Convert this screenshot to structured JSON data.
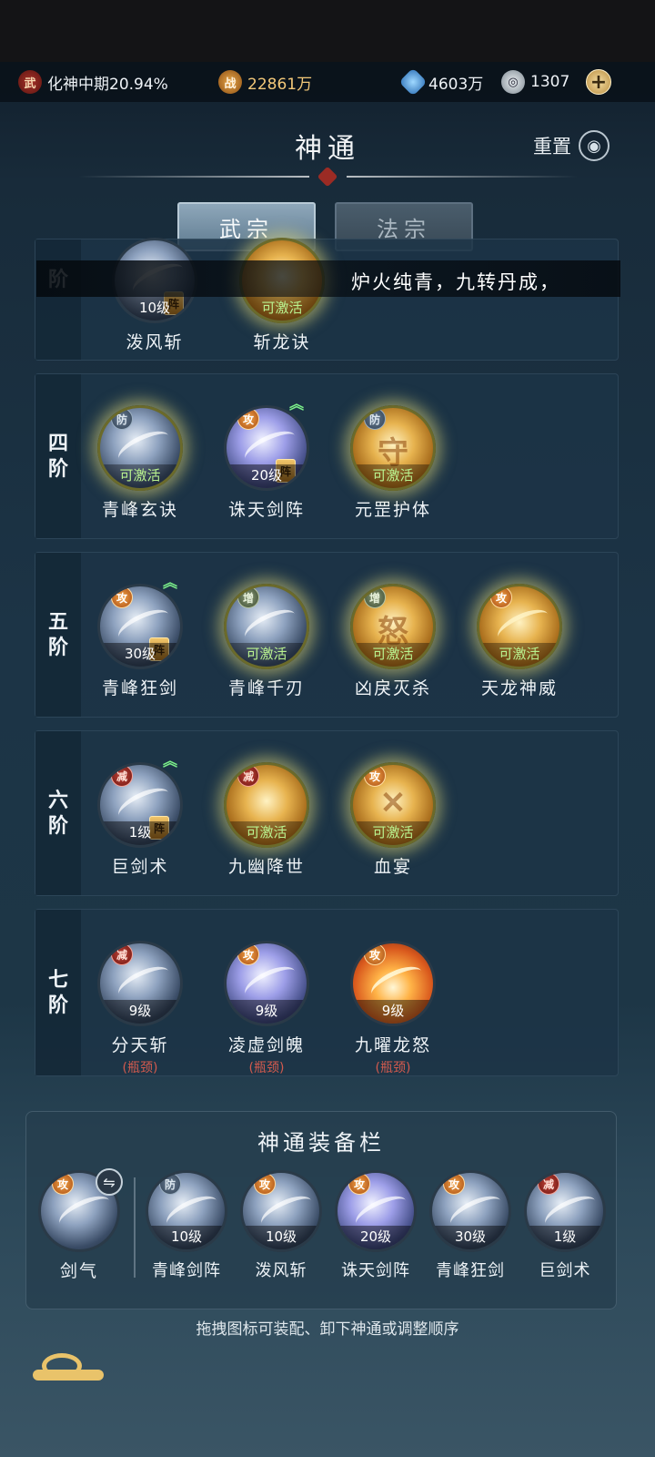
{
  "topbar": {
    "realm_icon": "武",
    "realm_text": "化神中期20.94%",
    "power_icon": "战",
    "power_value": "22861万",
    "gem_value": "4603万",
    "coin_value": "1307",
    "plus_label": "+"
  },
  "header": {
    "title": "神通",
    "reset_label": "重置"
  },
  "tabs": [
    {
      "label": "武宗",
      "active": true
    },
    {
      "label": "法宗",
      "active": false
    }
  ],
  "notice": "炉火纯青，九转丹成，",
  "tiers": [
    {
      "label": [
        "",
        "阶"
      ],
      "skills": [
        {
          "name": "泼风斩",
          "caption": "10级",
          "type": "",
          "formation": "阵"
        },
        {
          "name": "斩龙诀",
          "caption": "可激活",
          "type": ""
        }
      ]
    },
    {
      "label": [
        "四",
        "阶"
      ],
      "skills": [
        {
          "name": "青峰玄诀",
          "caption": "可激活",
          "type": "防"
        },
        {
          "name": "诛天剑阵",
          "caption": "20级",
          "type": "攻",
          "formation": "阵",
          "upgrade": "︽"
        },
        {
          "name": "元罡护体",
          "caption": "可激活",
          "type": "防"
        }
      ]
    },
    {
      "label": [
        "五",
        "阶"
      ],
      "skills": [
        {
          "name": "青峰狂剑",
          "caption": "30级",
          "type": "攻",
          "formation": "阵",
          "upgrade": "︽"
        },
        {
          "name": "青峰千刃",
          "caption": "可激活",
          "type": "增"
        },
        {
          "name": "凶戾灭杀",
          "caption": "可激活",
          "type": "增"
        },
        {
          "name": "天龙神威",
          "caption": "可激活",
          "type": "攻"
        }
      ]
    },
    {
      "label": [
        "六",
        "阶"
      ],
      "skills": [
        {
          "name": "巨剑术",
          "caption": "1级",
          "type": "减",
          "formation": "阵",
          "upgrade": "︽"
        },
        {
          "name": "九幽降世",
          "caption": "可激活",
          "type": "减"
        },
        {
          "name": "血宴",
          "caption": "可激活",
          "type": "攻"
        }
      ]
    },
    {
      "label": [
        "七",
        "阶"
      ],
      "skills": [
        {
          "name": "分天斩",
          "caption": "9级",
          "type": "减",
          "note": "(瓶颈)"
        },
        {
          "name": "凌虚剑魄",
          "caption": "9级",
          "type": "攻",
          "note": "(瓶颈)"
        },
        {
          "name": "九曜龙怒",
          "caption": "9级",
          "type": "攻",
          "note": "(瓶颈)"
        }
      ]
    }
  ],
  "equip": {
    "title": "神通装备栏",
    "base": {
      "name": "剑气",
      "type": "攻",
      "swap": "⇋"
    },
    "slots": [
      {
        "name": "青峰剑阵",
        "caption": "10级",
        "type": "防"
      },
      {
        "name": "泼风斩",
        "caption": "10级",
        "type": "攻"
      },
      {
        "name": "诛天剑阵",
        "caption": "20级",
        "type": "攻"
      },
      {
        "name": "青峰狂剑",
        "caption": "30级",
        "type": "攻"
      },
      {
        "name": "巨剑术",
        "caption": "1级",
        "type": "减"
      }
    ],
    "hint": "拖拽图标可装配、卸下神通或调整顺序"
  }
}
